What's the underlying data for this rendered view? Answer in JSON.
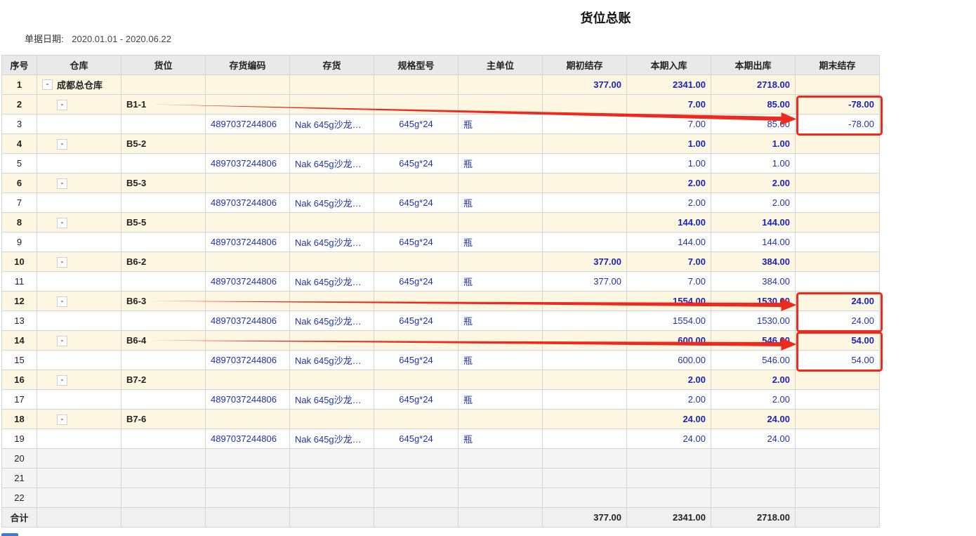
{
  "page": {
    "title": "货位总账"
  },
  "filter": {
    "date_label": "单据日期:",
    "date_range": "2020.01.01 - 2020.06.22"
  },
  "table": {
    "columns": [
      "序号",
      "仓库",
      "货位",
      "存货编码",
      "存货",
      "规格型号",
      "主单位",
      "期初结存",
      "本期入库",
      "本期出库",
      "期末结存"
    ],
    "rows": [
      {
        "seq": "1",
        "type": "group",
        "warehouse": "成都总仓库",
        "bin": "",
        "code": "",
        "item": "",
        "spec": "",
        "unit": "",
        "opening": "377.00",
        "in": "2341.00",
        "out": "2718.00",
        "closing": ""
      },
      {
        "seq": "2",
        "type": "group",
        "warehouse": "",
        "bin": "B1-1",
        "code": "",
        "item": "",
        "spec": "",
        "unit": "",
        "opening": "",
        "in": "7.00",
        "out": "85.00",
        "closing": "-78.00"
      },
      {
        "seq": "3",
        "type": "detail",
        "warehouse": "",
        "bin": "",
        "code": "4897037244806",
        "item": "Nak 645g沙龙…",
        "spec": "645g*24",
        "unit": "瓶",
        "opening": "",
        "in": "7.00",
        "out": "85.00",
        "closing": "-78.00"
      },
      {
        "seq": "4",
        "type": "group",
        "warehouse": "",
        "bin": "B5-2",
        "code": "",
        "item": "",
        "spec": "",
        "unit": "",
        "opening": "",
        "in": "1.00",
        "out": "1.00",
        "closing": ""
      },
      {
        "seq": "5",
        "type": "detail",
        "warehouse": "",
        "bin": "",
        "code": "4897037244806",
        "item": "Nak 645g沙龙…",
        "spec": "645g*24",
        "unit": "瓶",
        "opening": "",
        "in": "1.00",
        "out": "1.00",
        "closing": ""
      },
      {
        "seq": "6",
        "type": "group",
        "warehouse": "",
        "bin": "B5-3",
        "code": "",
        "item": "",
        "spec": "",
        "unit": "",
        "opening": "",
        "in": "2.00",
        "out": "2.00",
        "closing": ""
      },
      {
        "seq": "7",
        "type": "detail",
        "warehouse": "",
        "bin": "",
        "code": "4897037244806",
        "item": "Nak 645g沙龙…",
        "spec": "645g*24",
        "unit": "瓶",
        "opening": "",
        "in": "2.00",
        "out": "2.00",
        "closing": ""
      },
      {
        "seq": "8",
        "type": "group",
        "warehouse": "",
        "bin": "B5-5",
        "code": "",
        "item": "",
        "spec": "",
        "unit": "",
        "opening": "",
        "in": "144.00",
        "out": "144.00",
        "closing": ""
      },
      {
        "seq": "9",
        "type": "detail",
        "warehouse": "",
        "bin": "",
        "code": "4897037244806",
        "item": "Nak 645g沙龙…",
        "spec": "645g*24",
        "unit": "瓶",
        "opening": "",
        "in": "144.00",
        "out": "144.00",
        "closing": ""
      },
      {
        "seq": "10",
        "type": "group",
        "warehouse": "",
        "bin": "B6-2",
        "code": "",
        "item": "",
        "spec": "",
        "unit": "",
        "opening": "377.00",
        "in": "7.00",
        "out": "384.00",
        "closing": ""
      },
      {
        "seq": "11",
        "type": "detail",
        "warehouse": "",
        "bin": "",
        "code": "4897037244806",
        "item": "Nak 645g沙龙…",
        "spec": "645g*24",
        "unit": "瓶",
        "opening": "377.00",
        "in": "7.00",
        "out": "384.00",
        "closing": ""
      },
      {
        "seq": "12",
        "type": "group",
        "warehouse": "",
        "bin": "B6-3",
        "code": "",
        "item": "",
        "spec": "",
        "unit": "",
        "opening": "",
        "in": "1554.00",
        "out": "1530.00",
        "closing": "24.00"
      },
      {
        "seq": "13",
        "type": "detail",
        "warehouse": "",
        "bin": "",
        "code": "4897037244806",
        "item": "Nak 645g沙龙…",
        "spec": "645g*24",
        "unit": "瓶",
        "opening": "",
        "in": "1554.00",
        "out": "1530.00",
        "closing": "24.00"
      },
      {
        "seq": "14",
        "type": "group",
        "warehouse": "",
        "bin": "B6-4",
        "code": "",
        "item": "",
        "spec": "",
        "unit": "",
        "opening": "",
        "in": "600.00",
        "out": "546.00",
        "closing": "54.00"
      },
      {
        "seq": "15",
        "type": "detail",
        "warehouse": "",
        "bin": "",
        "code": "4897037244806",
        "item": "Nak 645g沙龙…",
        "spec": "645g*24",
        "unit": "瓶",
        "opening": "",
        "in": "600.00",
        "out": "546.00",
        "closing": "54.00"
      },
      {
        "seq": "16",
        "type": "group",
        "warehouse": "",
        "bin": "B7-2",
        "code": "",
        "item": "",
        "spec": "",
        "unit": "",
        "opening": "",
        "in": "2.00",
        "out": "2.00",
        "closing": ""
      },
      {
        "seq": "17",
        "type": "detail",
        "warehouse": "",
        "bin": "",
        "code": "4897037244806",
        "item": "Nak 645g沙龙…",
        "spec": "645g*24",
        "unit": "瓶",
        "opening": "",
        "in": "2.00",
        "out": "2.00",
        "closing": ""
      },
      {
        "seq": "18",
        "type": "group",
        "warehouse": "",
        "bin": "B7-6",
        "code": "",
        "item": "",
        "spec": "",
        "unit": "",
        "opening": "",
        "in": "24.00",
        "out": "24.00",
        "closing": ""
      },
      {
        "seq": "19",
        "type": "detail",
        "warehouse": "",
        "bin": "",
        "code": "4897037244806",
        "item": "Nak 645g沙龙…",
        "spec": "645g*24",
        "unit": "瓶",
        "opening": "",
        "in": "24.00",
        "out": "24.00",
        "closing": ""
      },
      {
        "seq": "20",
        "type": "empty"
      },
      {
        "seq": "21",
        "type": "empty"
      },
      {
        "seq": "22",
        "type": "empty"
      }
    ],
    "total": {
      "label": "合计",
      "opening": "377.00",
      "in": "2341.00",
      "out": "2718.00",
      "closing": ""
    },
    "collapse_symbol": "-"
  },
  "annotations": {
    "color": "#ee2a1f",
    "arrows": [
      {
        "from_row": "2",
        "to_row": "3"
      },
      {
        "from_row": "12",
        "to_row": "12"
      },
      {
        "from_row": "14",
        "to_row": "14"
      }
    ],
    "highlight_boxes": [
      {
        "rows": [
          "2",
          "3"
        ]
      },
      {
        "rows": [
          "12",
          "13"
        ]
      },
      {
        "rows": [
          "14",
          "15"
        ]
      }
    ]
  },
  "colors": {
    "header_bg": "#e9e9e9",
    "group_row_bg": "#fdf6e1",
    "link_text": "#2233aa",
    "total_bg": "#f0f0f0"
  }
}
